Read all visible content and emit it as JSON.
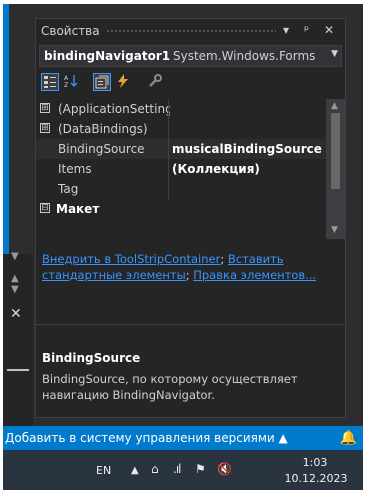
{
  "properties_window": {
    "title": "Свойства",
    "title_buttons": [
      "▾",
      "ᵖ",
      "✕"
    ],
    "object_selector": {
      "name": "bindingNavigator1",
      "type": "System.Windows.Forms"
    },
    "toolbar_icons": [
      "categorized-icon",
      "alphabetical-icon",
      "properties-icon",
      "events-icon",
      "property-pages-icon"
    ],
    "grid_rows": [
      {
        "expander": "⊞",
        "name": "(ApplicationSettings)",
        "value": ""
      },
      {
        "expander": "⊞",
        "name": "(DataBindings)",
        "value": ""
      },
      {
        "expander": "",
        "name": "BindingSource",
        "value": "musicalBindingSource"
      },
      {
        "expander": "",
        "name": "Items",
        "value": "(Коллекция)"
      },
      {
        "expander": "",
        "name": "Tag",
        "value": ""
      },
      {
        "expander": "⊟",
        "name": "Макет",
        "value": ""
      }
    ],
    "commands": {
      "link1": "Внедрить в ToolStripContainer",
      "sep1": "; ",
      "link2": "Вставить стандартные элементы",
      "sep2": "; ",
      "link3": "Правка элементов..."
    },
    "description": {
      "title": "BindingSource",
      "text": "BindingSource, по которому осуществляет навигацию BindingNavigator."
    }
  },
  "status_bar": {
    "source_control": "Добавить в систему управления версиями ▲",
    "bell_icon": "bell-icon",
    "color": "#007acc"
  },
  "taskbar": {
    "language": "EN",
    "time": "1:03",
    "date": "10.12.2023"
  }
}
